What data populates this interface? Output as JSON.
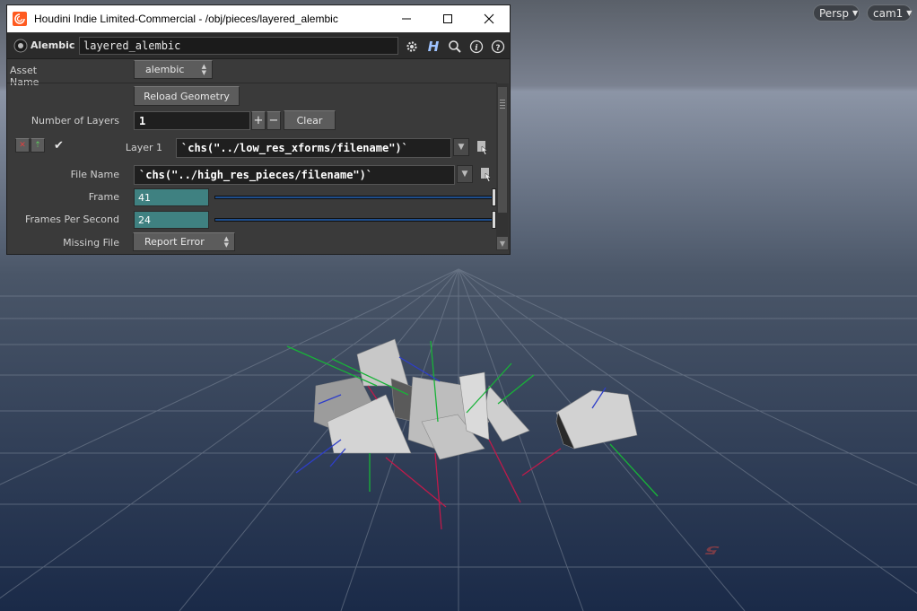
{
  "window": {
    "title": "Houdini Indie Limited-Commercial - /obj/pieces/layered_alembic",
    "minimize_glyph": "—",
    "maximize_glyph": "☐",
    "close_glyph": "✕"
  },
  "node": {
    "type_label": "Alembic",
    "name": "layered_alembic"
  },
  "toolbar": {
    "icons": [
      "gear-icon",
      "houdini-help-icon",
      "search-icon",
      "info-icon",
      "help-icon"
    ],
    "h_glyph": "H",
    "info_glyph": "i",
    "help_glyph": "?"
  },
  "params": {
    "asset_name_label": "Asset Name",
    "asset_name_value": "alembic",
    "reload_label": "Reload Geometry",
    "num_layers_label": "Number of Layers",
    "num_layers_value": "1",
    "plus_label": "+",
    "minus_label": "−",
    "clear_label": "Clear",
    "layer1_label": "Layer 1",
    "layer1_value": "`chs(\"../low_res_xforms/filename\")`",
    "file_name_label": "File Name",
    "file_name_value": "`chs(\"../high_res_pieces/filename\")`",
    "frame_label": "Frame",
    "frame_value": "41",
    "fps_label": "Frames Per Second",
    "fps_value": "24",
    "missing_file_label": "Missing File",
    "missing_file_value": "Report Error"
  },
  "viewport": {
    "persp_label": "Persp",
    "cam_label": "cam1",
    "grid_number": "5"
  },
  "colors": {
    "accent_teal": "#3f8181",
    "slider_blue": "#1f4e8c",
    "panel_bg": "#3a3a3a",
    "houdini_orange": "#ff5a1f"
  }
}
